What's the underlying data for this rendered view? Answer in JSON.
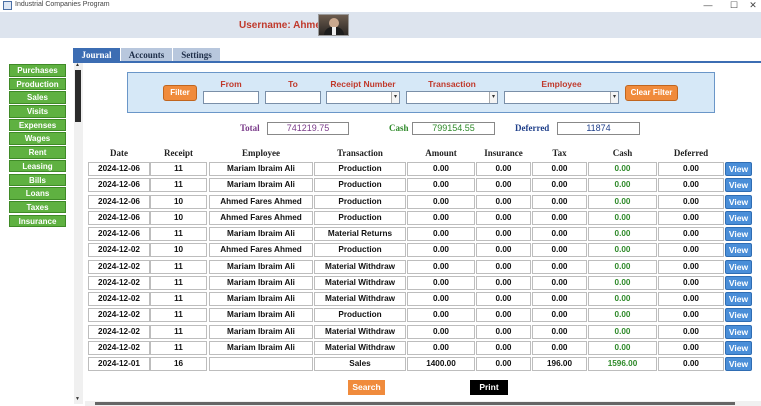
{
  "window": {
    "title": "Industrial Companies Program",
    "controls": [
      "—",
      "☐",
      "✕"
    ]
  },
  "user": {
    "label": "Username: Ahmed"
  },
  "sidebar": {
    "items": [
      "Purchases",
      "Production",
      "Sales",
      "Visits",
      "Expenses",
      "Wages",
      "Rent",
      "Leasing",
      "Bills",
      "Loans",
      "Taxes",
      "Insurance"
    ]
  },
  "tabs": [
    "Journal",
    "Accounts",
    "Settings"
  ],
  "filter": {
    "filter_label": "Filter",
    "clear_label": "Clear Filter",
    "from_label": "From",
    "to_label": "To",
    "receipt_label": "Receipt Number",
    "transaction_label": "Transaction",
    "employee_label": "Employee"
  },
  "totals": {
    "total_label": "Total",
    "total_value": "741219.75",
    "cash_label": "Cash",
    "cash_value": "799154.55",
    "deferred_label": "Deferred",
    "deferred_value": "11874"
  },
  "table": {
    "headers": [
      "Date",
      "Receipt",
      "Employee",
      "Transaction",
      "Amount",
      "Insurance",
      "Tax",
      "Cash",
      "Deferred"
    ],
    "view_label": "View",
    "rows": [
      [
        "2024-12-06",
        "11",
        "Mariam Ibraim Ali",
        "Production",
        "0.00",
        "0.00",
        "0.00",
        "0.00",
        "0.00"
      ],
      [
        "2024-12-06",
        "11",
        "Mariam Ibraim Ali",
        "Production",
        "0.00",
        "0.00",
        "0.00",
        "0.00",
        "0.00"
      ],
      [
        "2024-12-06",
        "10",
        "Ahmed Fares Ahmed",
        "Production",
        "0.00",
        "0.00",
        "0.00",
        "0.00",
        "0.00"
      ],
      [
        "2024-12-06",
        "10",
        "Ahmed Fares Ahmed",
        "Production",
        "0.00",
        "0.00",
        "0.00",
        "0.00",
        "0.00"
      ],
      [
        "2024-12-06",
        "11",
        "Mariam Ibraim Ali",
        "Material Returns",
        "0.00",
        "0.00",
        "0.00",
        "0.00",
        "0.00"
      ],
      [
        "2024-12-02",
        "10",
        "Ahmed Fares Ahmed",
        "Production",
        "0.00",
        "0.00",
        "0.00",
        "0.00",
        "0.00"
      ],
      [
        "2024-12-02",
        "11",
        "Mariam Ibraim Ali",
        "Material Withdraw",
        "0.00",
        "0.00",
        "0.00",
        "0.00",
        "0.00"
      ],
      [
        "2024-12-02",
        "11",
        "Mariam Ibraim Ali",
        "Material Withdraw",
        "0.00",
        "0.00",
        "0.00",
        "0.00",
        "0.00"
      ],
      [
        "2024-12-02",
        "11",
        "Mariam Ibraim Ali",
        "Material Withdraw",
        "0.00",
        "0.00",
        "0.00",
        "0.00",
        "0.00"
      ],
      [
        "2024-12-02",
        "11",
        "Mariam Ibraim Ali",
        "Production",
        "0.00",
        "0.00",
        "0.00",
        "0.00",
        "0.00"
      ],
      [
        "2024-12-02",
        "11",
        "Mariam Ibraim Ali",
        "Material Withdraw",
        "0.00",
        "0.00",
        "0.00",
        "0.00",
        "0.00"
      ],
      [
        "2024-12-02",
        "11",
        "Mariam Ibraim Ali",
        "Material Withdraw",
        "0.00",
        "0.00",
        "0.00",
        "0.00",
        "0.00"
      ],
      [
        "2024-12-01",
        "16",
        "",
        "Sales",
        "1400.00",
        "0.00",
        "196.00",
        "1596.00",
        "0.00"
      ]
    ]
  },
  "footer": {
    "search_label": "Search",
    "print_label": "Print"
  },
  "colors": {
    "accent": "#3c6db3",
    "sidebar_green": "#5fb141",
    "filter_orange": "#f08b3c",
    "cash_green": "#2f8a2a",
    "username_red": "#c0392b"
  }
}
